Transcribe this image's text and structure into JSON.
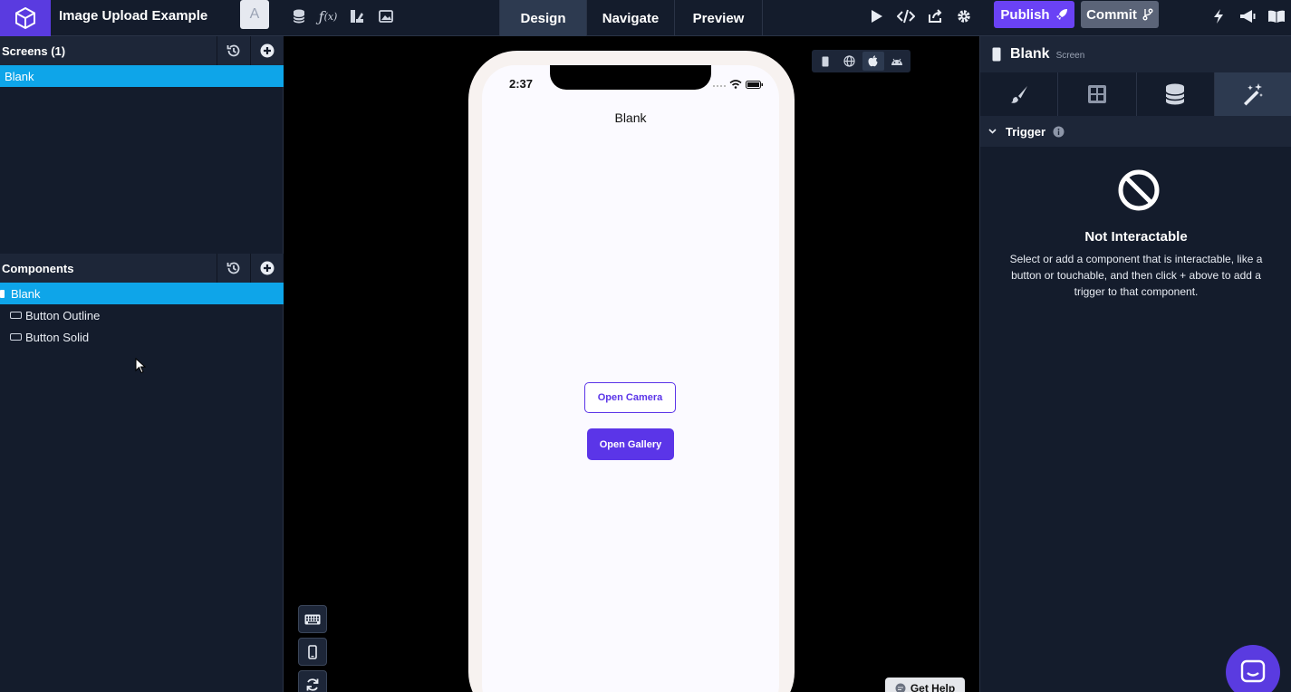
{
  "topbar": {
    "project_title": "Image Upload Example",
    "avatar_letter": "A",
    "tabs": [
      {
        "label": "Design",
        "active": true
      },
      {
        "label": "Navigate",
        "active": false
      },
      {
        "label": "Preview",
        "active": false
      }
    ],
    "publish_label": "Publish",
    "commit_label": "Commit"
  },
  "left_panel": {
    "screens_header": "Screens (1)",
    "screens": [
      {
        "label": "Blank",
        "selected": true
      }
    ],
    "components_header": "Components",
    "components": [
      {
        "label": "Blank",
        "selected": true
      },
      {
        "label": "Button Outline",
        "selected": false
      },
      {
        "label": "Button Solid",
        "selected": false
      }
    ]
  },
  "canvas": {
    "status_time": "2:37",
    "screen_title": "Blank",
    "button_outline_label": "Open Camera",
    "button_solid_label": "Open Gallery",
    "get_help_label": "Get Help"
  },
  "right_panel": {
    "title": "Blank",
    "subtitle": "Screen",
    "trigger_label": "Trigger",
    "empty_title": "Not Interactable",
    "empty_desc": "Select or add a component that is interactable, like a button or touchable, and then click + above to add a trigger to that component."
  },
  "colors": {
    "brand": "#5a3be0",
    "selection": "#0ea5e9",
    "panel_bg": "#141c2c",
    "button_primary": "#5b35e8"
  }
}
